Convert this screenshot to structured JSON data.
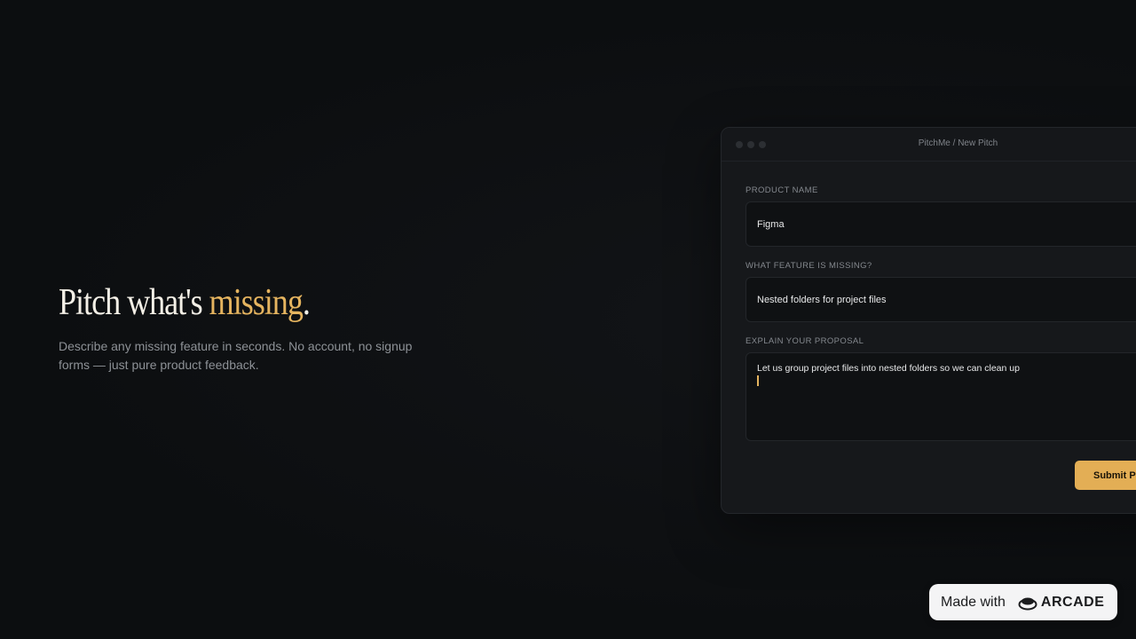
{
  "hero": {
    "title_prefix": "Pitch what's ",
    "title_accent": "missing",
    "title_suffix": ".",
    "subtitle": "Describe any missing feature in seconds. No account, no signup forms — just pure product feedback."
  },
  "window": {
    "title": "PitchMe / New Pitch"
  },
  "form": {
    "product_name": {
      "label": "PRODUCT NAME",
      "value": "Figma"
    },
    "missing_feature": {
      "label": "WHAT FEATURE IS MISSING?",
      "value": "Nested folders for project files"
    },
    "proposal": {
      "label": "EXPLAIN YOUR PROPOSAL",
      "value": "Let us group project files into nested folders so we can clean up"
    },
    "submit_label": "Submit Pitch"
  },
  "badge": {
    "text": "Made with",
    "brand": "ARCADE"
  },
  "colors": {
    "background": "#0d0f11",
    "accent": "#e5b45f",
    "button": "#e3ae55"
  }
}
